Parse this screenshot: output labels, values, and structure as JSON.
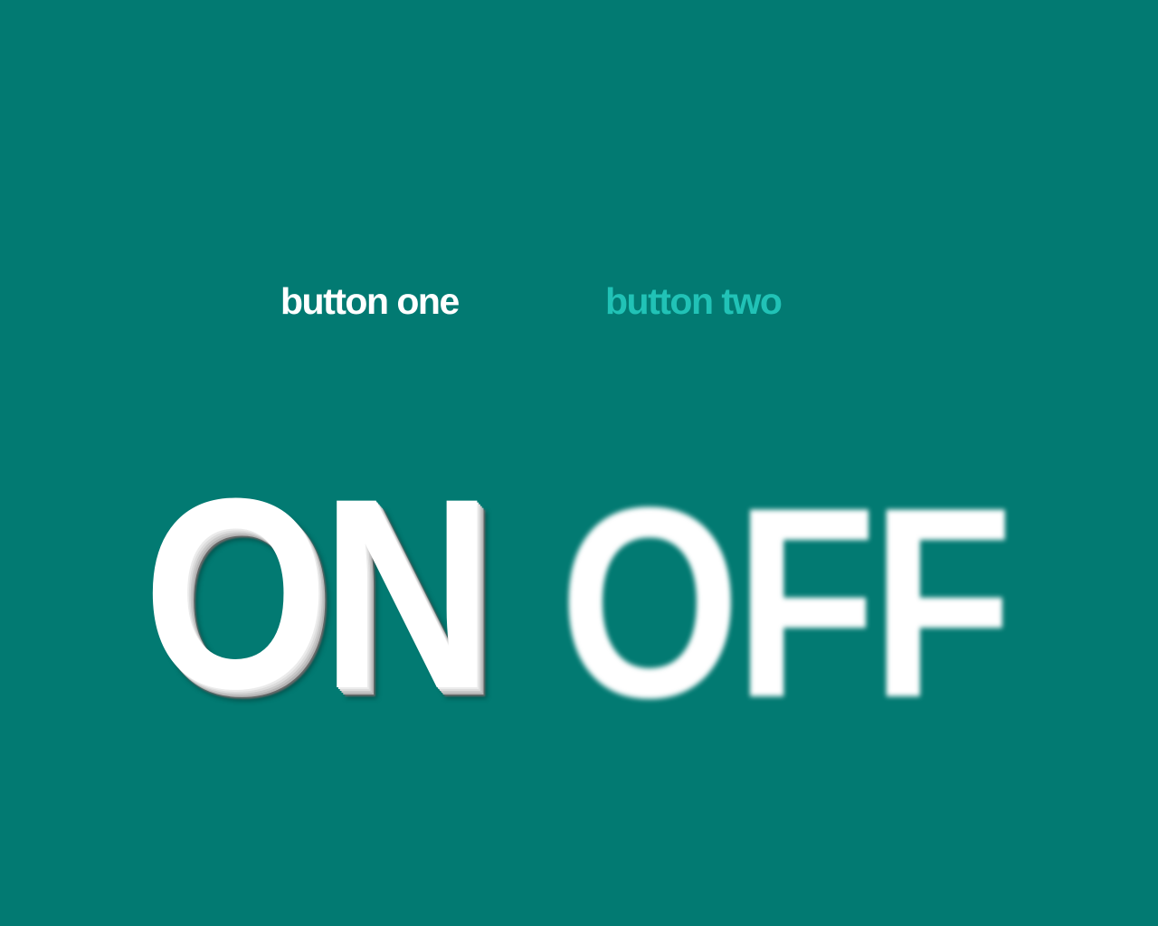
{
  "colors": {
    "background": "#027a72",
    "button_active": "#ffffff",
    "button_inactive": "#21c2b6",
    "word": "#ffffff"
  },
  "buttons": {
    "one": "button one",
    "two": "button two"
  },
  "display": {
    "on_word": "ON",
    "off_word": "OFF"
  }
}
